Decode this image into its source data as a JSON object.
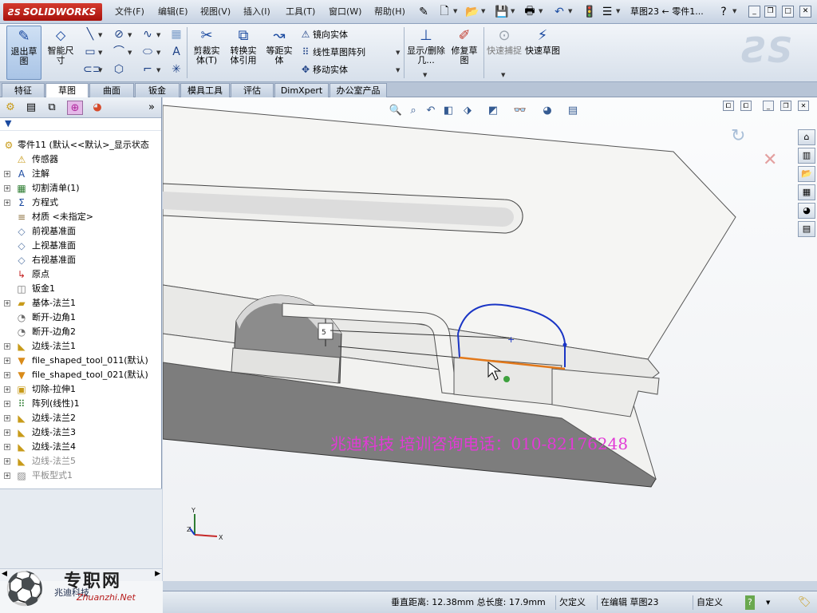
{
  "app": {
    "brand": "SOLIDWORKS",
    "doc_title": "草图23 ← 零件1...",
    "menus": [
      "文件(F)",
      "编辑(E)",
      "视图(V)",
      "插入(I)",
      "工具(T)",
      "窗口(W)",
      "帮助(H)"
    ]
  },
  "toolbar": {
    "exit_sketch": "退出草图",
    "smart_dim": "智能尺寸",
    "trim": "剪裁实体(T)",
    "convert": "转换实体引用",
    "offset": "等距实体",
    "mirror": "镜向实体",
    "linear_pattern": "线性草图阵列",
    "move": "移动实体",
    "show_delete": "显示/删除几...",
    "repair": "修复草图",
    "quick_snap": "快速捕捉",
    "rapid_sketch": "快速草图"
  },
  "tabs": [
    "特征",
    "草图",
    "曲面",
    "钣金",
    "模具工具",
    "评估",
    "DimXpert",
    "办公室产品"
  ],
  "active_tab": "草图",
  "tree": {
    "root": "零件11  (默认<<默认>_显示状态",
    "items": [
      {
        "label": "传感器",
        "icon": "sensor-icon",
        "exp": false
      },
      {
        "label": "注解",
        "icon": "annotation-icon",
        "exp": true
      },
      {
        "label": "切割清单(1)",
        "icon": "cutlist-icon",
        "exp": true
      },
      {
        "label": "方程式",
        "icon": "equation-icon",
        "exp": true
      },
      {
        "label": "材质 <未指定>",
        "icon": "material-icon",
        "exp": false
      },
      {
        "label": "前视基准面",
        "icon": "plane-icon",
        "exp": false
      },
      {
        "label": "上视基准面",
        "icon": "plane-icon",
        "exp": false
      },
      {
        "label": "右视基准面",
        "icon": "plane-icon",
        "exp": false
      },
      {
        "label": "原点",
        "icon": "origin-icon",
        "exp": false
      },
      {
        "label": "钣金1",
        "icon": "sheetmetal-icon",
        "exp": false
      },
      {
        "label": "基体-法兰1",
        "icon": "flange-icon",
        "exp": true
      },
      {
        "label": "断开-边角1",
        "icon": "corner-icon",
        "exp": false
      },
      {
        "label": "断开-边角2",
        "icon": "corner-icon",
        "exp": false
      },
      {
        "label": "边线-法兰1",
        "icon": "edge-flange-icon",
        "exp": true
      },
      {
        "label": "file_shaped_tool_011(默认)",
        "icon": "formtool-icon",
        "exp": true
      },
      {
        "label": "file_shaped_tool_021(默认)",
        "icon": "formtool-icon",
        "exp": true
      },
      {
        "label": "切除-拉伸1",
        "icon": "cut-extrude-icon",
        "exp": true
      },
      {
        "label": "阵列(线性)1",
        "icon": "pattern-icon",
        "exp": true
      },
      {
        "label": "边线-法兰2",
        "icon": "edge-flange-icon",
        "exp": true
      },
      {
        "label": "边线-法兰3",
        "icon": "edge-flange-icon",
        "exp": true
      },
      {
        "label": "边线-法兰4",
        "icon": "edge-flange-icon",
        "exp": true
      },
      {
        "label": "边线-法兰5",
        "icon": "edge-flange-icon",
        "exp": true,
        "grey": true
      },
      {
        "label": "平板型式1",
        "icon": "flat-pattern-icon",
        "exp": true,
        "grey": true
      }
    ]
  },
  "graphics": {
    "watermark": "兆迪科技      培训咨询电话：010-82176248",
    "dimension_label": "5",
    "axis_x": "X",
    "axis_y": "Y",
    "axis_z": "Z"
  },
  "status": {
    "measure": "垂直距离: 12.38mm 总长度: 17.9mm",
    "state": "欠定义",
    "editing": "在编辑 草图23",
    "custom": "自定义",
    "help": "?"
  },
  "branding": {
    "site": "专职网",
    "site_sub": "Zhuanzhi.Net",
    "company": "兆迪科技"
  }
}
